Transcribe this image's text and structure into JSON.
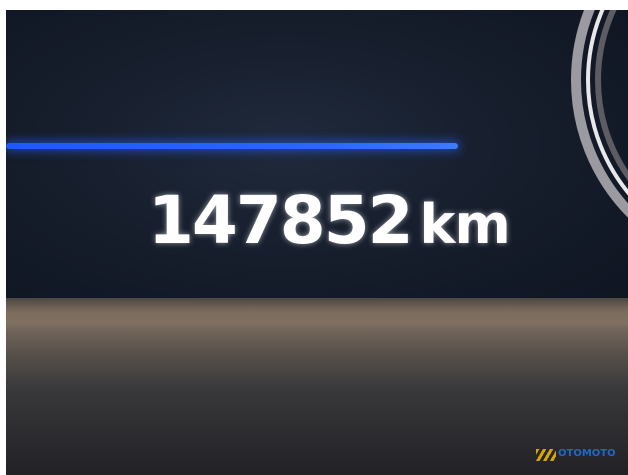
{
  "odometer": {
    "value": "147852",
    "unit": "km"
  },
  "watermark": {
    "text": "OTOMOTO"
  },
  "colors": {
    "display_background": "#151c2a",
    "indicator_bar": "#2a66ff",
    "digits": "#ffffff",
    "bezel": "#4a4642",
    "watermark_text": "#1e6fd9",
    "watermark_stripes": "#e8b400"
  }
}
